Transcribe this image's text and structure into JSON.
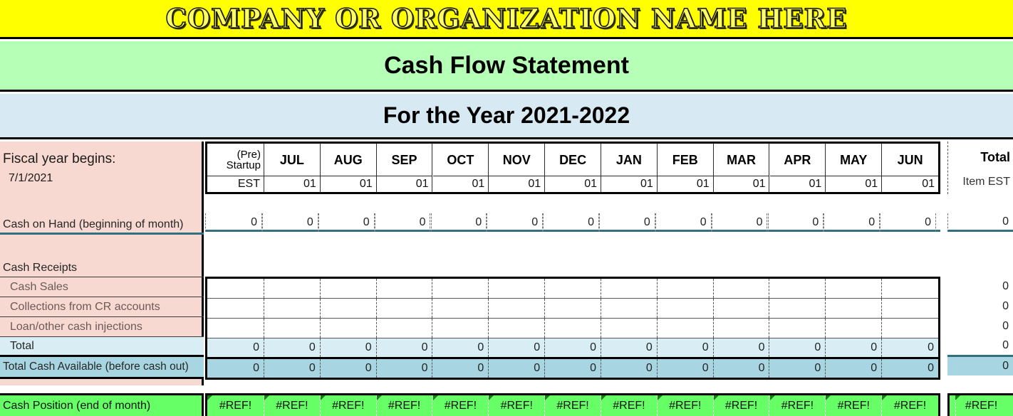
{
  "header": {
    "company": "COMPANY OR ORGANIZATION NAME HERE",
    "statement_title": "Cash Flow Statement",
    "period": "For the Year 2021-2022"
  },
  "fiscal": {
    "label": "Fiscal year begins:",
    "date": "7/1/2021"
  },
  "columns": {
    "pre_startup_line1": "(Pre)",
    "pre_startup_line2": "Startup",
    "pre_startup_est": "EST",
    "months": [
      "JUL",
      "AUG",
      "SEP",
      "OCT",
      "NOV",
      "DEC",
      "JAN",
      "FEB",
      "MAR",
      "APR",
      "MAY",
      "JUN"
    ],
    "month_est": [
      "01",
      "01",
      "01",
      "01",
      "01",
      "01",
      "01",
      "01",
      "01",
      "01",
      "01",
      "01"
    ],
    "total_label": "Total",
    "total_sub": "Item EST"
  },
  "rows": {
    "cash_on_hand": {
      "label": "Cash on Hand (beginning of month)",
      "values": [
        "0",
        "0",
        "0",
        "0",
        "0",
        "0",
        "0",
        "0",
        "0",
        "0",
        "0",
        "0",
        "0"
      ],
      "total": "0"
    },
    "cash_receipts_heading": "Cash Receipts",
    "items": [
      {
        "label": "Cash Sales",
        "values": [
          "",
          "",
          "",
          "",
          "",
          "",
          "",
          "",
          "",
          "",
          "",
          "",
          ""
        ],
        "total": "0"
      },
      {
        "label": "Collections from CR accounts",
        "values": [
          "",
          "",
          "",
          "",
          "",
          "",
          "",
          "",
          "",
          "",
          "",
          "",
          ""
        ],
        "total": "0"
      },
      {
        "label": "Loan/other cash injections",
        "values": [
          "",
          "",
          "",
          "",
          "",
          "",
          "",
          "",
          "",
          "",
          "",
          "",
          ""
        ],
        "total": "0"
      }
    ],
    "receipts_total": {
      "label": "Total",
      "values": [
        "0",
        "0",
        "0",
        "0",
        "0",
        "0",
        "0",
        "0",
        "0",
        "0",
        "0",
        "0",
        "0"
      ],
      "total": "0"
    },
    "total_cash_available": {
      "label": "Total Cash Available (before cash out)",
      "values": [
        "0",
        "0",
        "0",
        "0",
        "0",
        "0",
        "0",
        "0",
        "0",
        "0",
        "0",
        "0",
        "0"
      ],
      "total": "0"
    },
    "cash_position": {
      "label": "Cash Position (end of month)",
      "values": [
        "#REF!",
        "#REF!",
        "#REF!",
        "#REF!",
        "#REF!",
        "#REF!",
        "#REF!",
        "#REF!",
        "#REF!",
        "#REF!",
        "#REF!",
        "#REF!",
        "#REF!"
      ],
      "total": "#REF!"
    }
  },
  "colors": {
    "title_band": "#ffff00",
    "statement_band": "#b6ffb6",
    "period_band": "#d7e9f3",
    "label_column": "#f8d9d1",
    "subtotal": "#d9eef4",
    "total_available": "#a7d6e2",
    "cash_position": "#66ff66",
    "error_text": "#111111"
  }
}
